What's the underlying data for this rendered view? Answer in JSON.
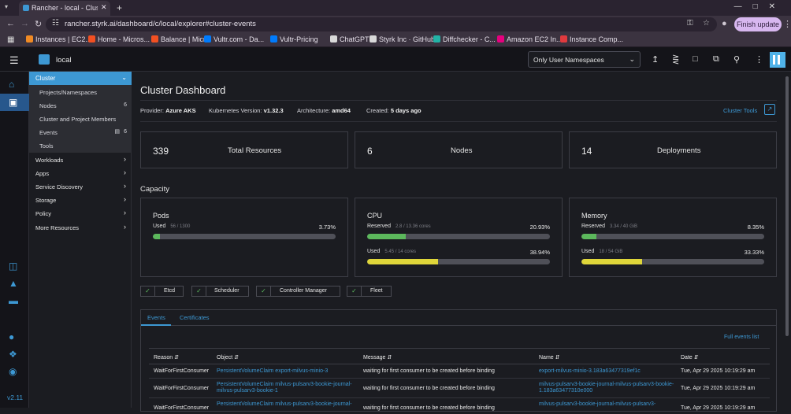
{
  "browser": {
    "tab_title": "Rancher - local - Cluster Da",
    "url": "rancher.styrk.ai/dashboard/c/local/explorer#cluster-events",
    "finish_update": "Finish update",
    "bookmarks": [
      {
        "label": "Instances | EC2...",
        "color": "#f08a24"
      },
      {
        "label": "Home - Micros...",
        "color": "#f25022"
      },
      {
        "label": "Balance | Micr...",
        "color": "#f25022"
      },
      {
        "label": "Vultr.com - Da...",
        "color": "#007bfc"
      },
      {
        "label": "Vultr-Pricing",
        "color": "#007bfc"
      },
      {
        "label": "ChatGPT",
        "color": "#d9d9d9"
      },
      {
        "label": "Styrk Inc · GitHub",
        "color": "#d9d9d9"
      },
      {
        "label": "Diffchecker - C...",
        "color": "#22b3a6"
      },
      {
        "label": "Amazon EC2 In...",
        "color": "#e6007e"
      },
      {
        "label": "Instance Comp...",
        "color": "#e03a3e"
      }
    ]
  },
  "header": {
    "cluster_name": "local",
    "namespace_filter": "Only User Namespaces"
  },
  "rail": {
    "version": "v2.11"
  },
  "sidebar": {
    "cluster_group": "Cluster",
    "sub_items": [
      {
        "label": "Projects/Namespaces",
        "count": ""
      },
      {
        "label": "Nodes",
        "count": "6"
      },
      {
        "label": "Cluster and Project Members",
        "count": ""
      },
      {
        "label": "Events",
        "count": "6"
      },
      {
        "label": "Tools",
        "count": ""
      }
    ],
    "groups": [
      "Workloads",
      "Apps",
      "Service Discovery",
      "Storage",
      "Policy",
      "More Resources"
    ]
  },
  "dashboard": {
    "title": "Cluster Dashboard",
    "provider_label": "Provider:",
    "provider": "Azure AKS",
    "k8s_label": "Kubernetes Version:",
    "k8s": "v1.32.3",
    "arch_label": "Architecture:",
    "arch": "amd64",
    "created_label": "Created:",
    "created": "5 days ago",
    "cluster_tools": "Cluster Tools",
    "stats": [
      {
        "value": "339",
        "label": "Total Resources"
      },
      {
        "value": "6",
        "label": "Nodes"
      },
      {
        "value": "14",
        "label": "Deployments"
      }
    ],
    "capacity_title": "Capacity",
    "pods": {
      "title": "Pods",
      "used_label": "Used",
      "used_detail": "56 / 1300",
      "used_pct": "3.73%",
      "used_frac": 0.0373
    },
    "cpu": {
      "title": "CPU",
      "reserved_label": "Reserved",
      "reserved_detail": "2.8 / 13.36 cores",
      "reserved_pct": "20.93%",
      "reserved_frac": 0.2093,
      "used_label": "Used",
      "used_detail": "5.45 / 14 cores",
      "used_pct": "38.94%",
      "used_frac": 0.3894
    },
    "memory": {
      "title": "Memory",
      "reserved_label": "Reserved",
      "reserved_detail": "3.34 / 40 GiB",
      "reserved_pct": "8.35%",
      "reserved_frac": 0.0835,
      "used_label": "Used",
      "used_detail": "18 / 54 GiB",
      "used_pct": "33.33%",
      "used_frac": 0.3333
    },
    "components": [
      "Etcd",
      "Scheduler",
      "Controller Manager",
      "Fleet"
    ],
    "colors": {
      "accent": "#3d98d3",
      "green": "#5cb85c",
      "yellow": "#dfd63a"
    }
  },
  "events": {
    "tabs": [
      "Events",
      "Certificates"
    ],
    "full_list": "Full events list",
    "columns": [
      "Reason",
      "Object",
      "Message",
      "Name",
      "Date"
    ],
    "rows": [
      {
        "reason": "WaitForFirstConsumer",
        "object": "PersistentVolumeClaim export-milvus-minio-3",
        "message": "waiting for first consumer to be created before binding",
        "name": "export-milvus-minio-3.183a63477319ef1c",
        "date": "Tue, Apr 29 2025  10:19:29 am"
      },
      {
        "reason": "WaitForFirstConsumer",
        "object": "PersistentVolumeClaim milvus-pulsarv3-bookie-journal-milvus-pulsarv3-bookie-1",
        "message": "waiting for first consumer to be created before binding",
        "name": "milvus-pulsarv3-bookie-journal-milvus-pulsarv3-bookie-1.183a63477310e000",
        "date": "Tue, Apr 29 2025  10:19:29 am"
      },
      {
        "reason": "WaitForFirstConsumer",
        "object": "PersistentVolumeClaim milvus-pulsarv3-bookie-journal-",
        "message": "waiting for first consumer to be created before binding",
        "name": "milvus-pulsarv3-bookie-journal-milvus-pulsarv3-",
        "date": "Tue, Apr 29 2025  10:19:29 am"
      }
    ]
  }
}
